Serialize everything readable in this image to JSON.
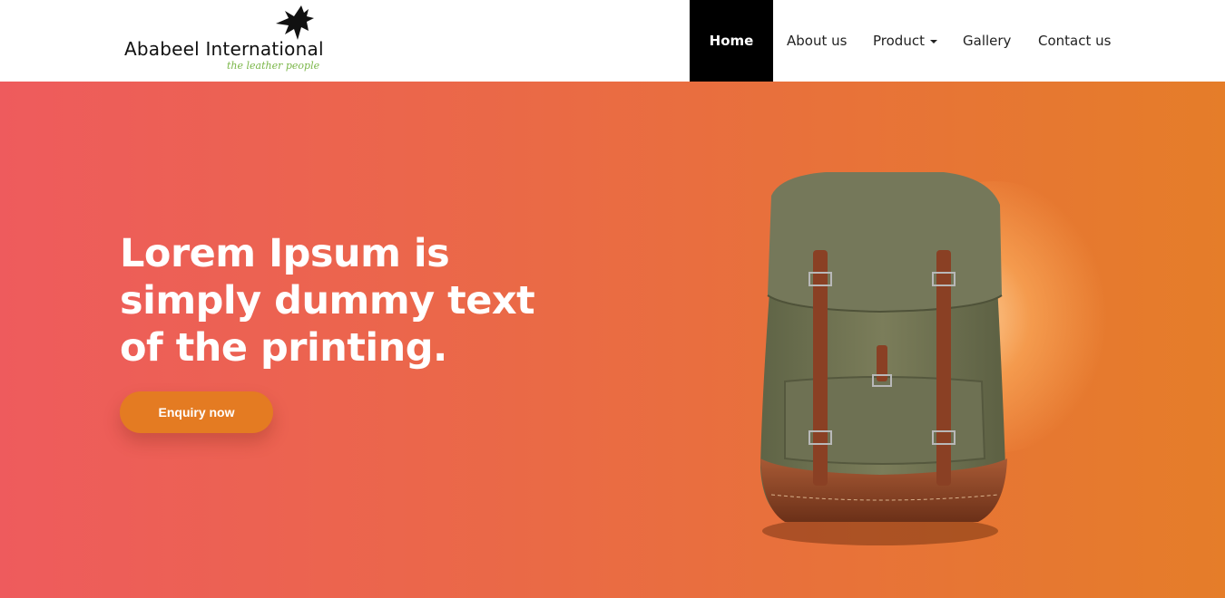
{
  "brand": {
    "name": "Ababeel International",
    "tagline": "the leather people"
  },
  "nav": {
    "items": [
      {
        "label": "Home",
        "active": true
      },
      {
        "label": "About us"
      },
      {
        "label": "Product",
        "has_dropdown": true
      },
      {
        "label": "Gallery"
      },
      {
        "label": "Contact us"
      }
    ]
  },
  "hero": {
    "headline_lines": [
      "Lorem Ipsum is",
      "simply dummy text",
      "of the printing."
    ],
    "cta_label": "Enquiry now"
  },
  "colors": {
    "nav_active_bg": "#000000",
    "hero_gradient_start": "#ee5b5d",
    "hero_gradient_end": "#e57d29",
    "cta_bg": "#e47b22",
    "tagline": "#7ab648"
  },
  "icons": {
    "logo_mark": "bird-icon",
    "product_dropdown": "caret-down-icon"
  }
}
